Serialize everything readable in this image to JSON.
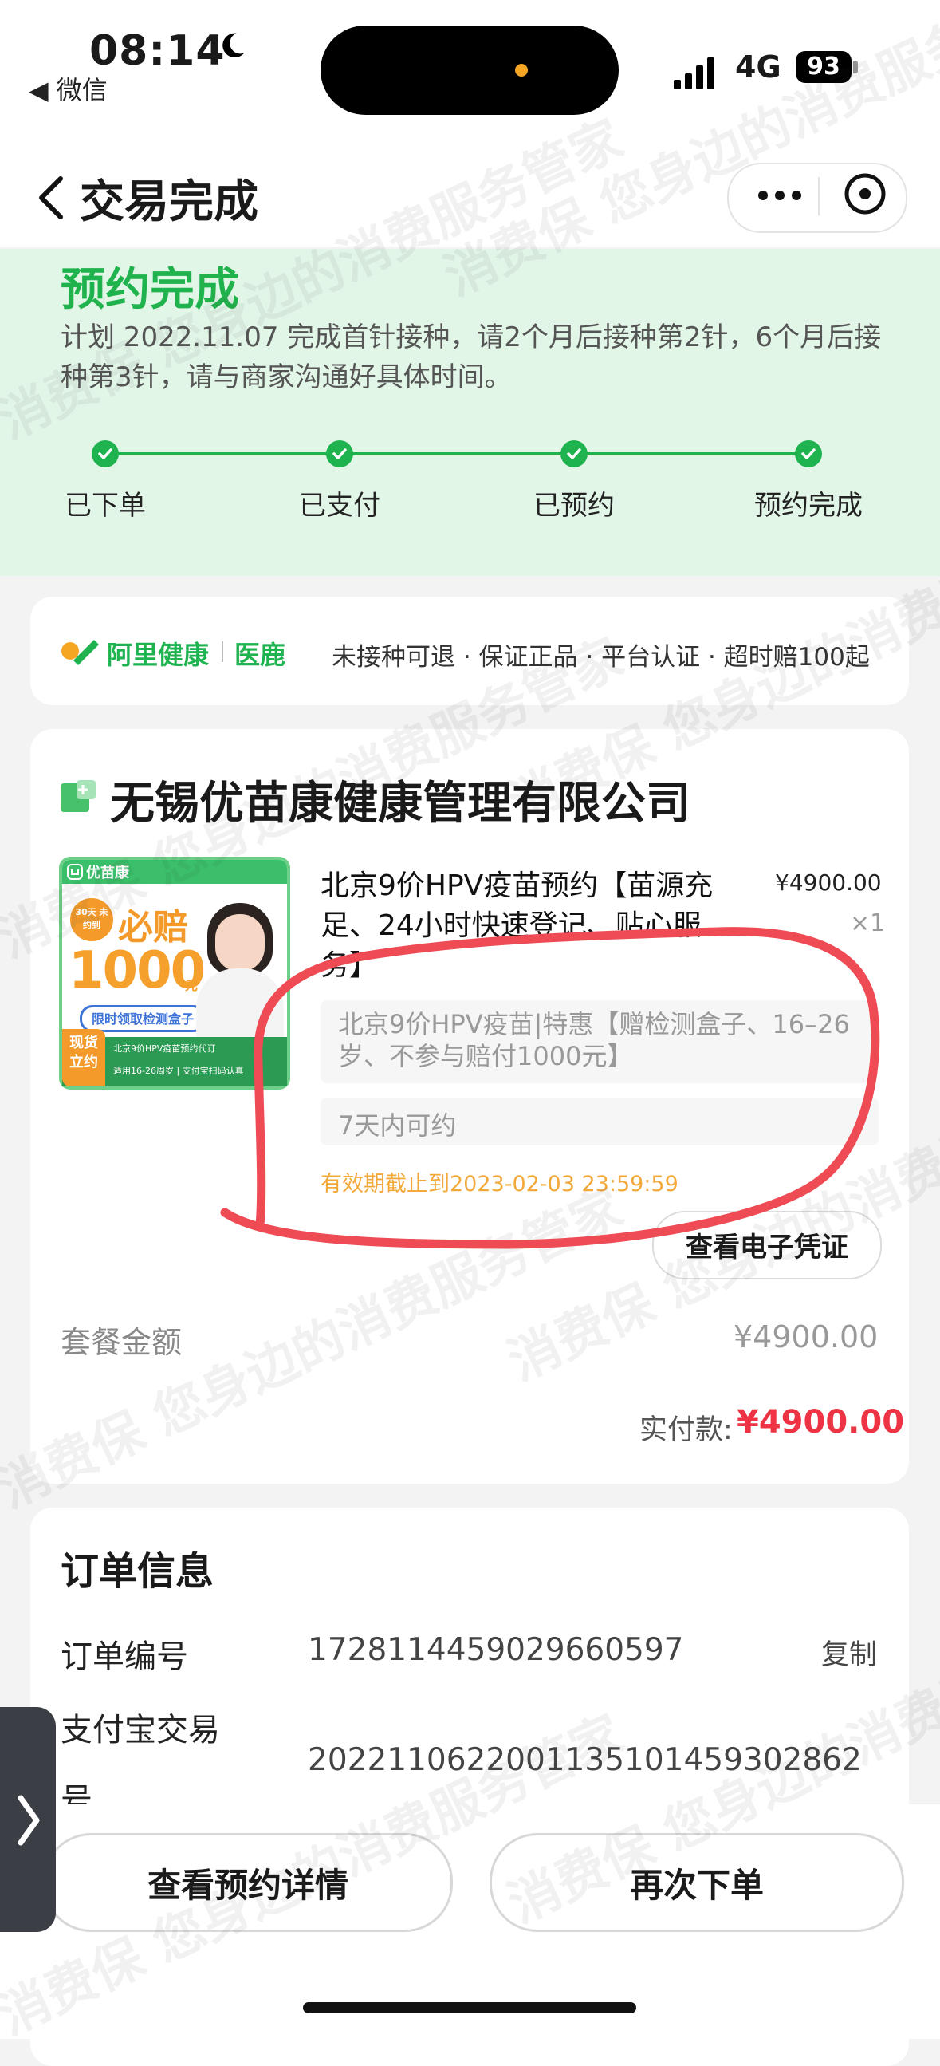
{
  "status_bar": {
    "time": "08:14",
    "back_app": "◀ 微信",
    "network": "4G",
    "battery": "93"
  },
  "nav": {
    "title": "交易完成"
  },
  "progress": {
    "title": "预约完成",
    "plan_text": "计划 2022.11.07 完成首针接种，请2个月后接种第2针，6个月后接种第3针，请与商家沟通好具体时间。",
    "steps": [
      "已下单",
      "已支付",
      "已预约",
      "预约完成"
    ]
  },
  "assurance": {
    "brand": "阿里健康",
    "sub_brand": "医鹿",
    "text": "未接种可退 · 保证正品 · 平台认证 · 超时赔100起"
  },
  "order": {
    "shop_name": "无锡优苗康健康管理有限公司",
    "product_title": "北京9价HPV疫苗预约【苗源充足、24小时快速登记、贴心服务】",
    "price": "¥4900.00",
    "qty": "×1",
    "sku": "北京9价HPV疫苗|特惠【赠检测盒子、16–26岁、不参与赔付1000元】",
    "appoint_note": "7天内可约",
    "valid_until": "有效期截止到2023-02-03 23:59:59",
    "voucher_button": "查看电子凭证",
    "package_label": "套餐金额",
    "package_value": "¥4900.00",
    "paid_label": "实付款:",
    "paid_value": "¥4900.00"
  },
  "product_image": {
    "brand": "优苗康",
    "badge": "30天 未约到",
    "headline": "必赔",
    "amount": "1000",
    "unit": "元",
    "tag": "限时领取检测盒子",
    "corner": "现货\n立约",
    "footer1": "北京9价HPV疫苗预约代订",
    "footer2": "适用16-26周岁 | 支付宝扫码认真"
  },
  "info": {
    "title": "订单信息",
    "order_no_label": "订单编号",
    "order_no": "1728114459029660597",
    "copy": "复制",
    "alipay_label_1": "支付宝交易",
    "alipay_label_2": "号",
    "alipay_no": "2022110622001135101459302862"
  },
  "bottom": {
    "detail": "查看预约详情",
    "reorder": "再次下单"
  },
  "watermark": {
    "text": "消费保 您身边的消费服务管家"
  },
  "colors": {
    "green": "#1fb34f",
    "price_red": "#ee3344",
    "annotation": "#ee4b55",
    "valid_orange": "#f3a83a"
  }
}
